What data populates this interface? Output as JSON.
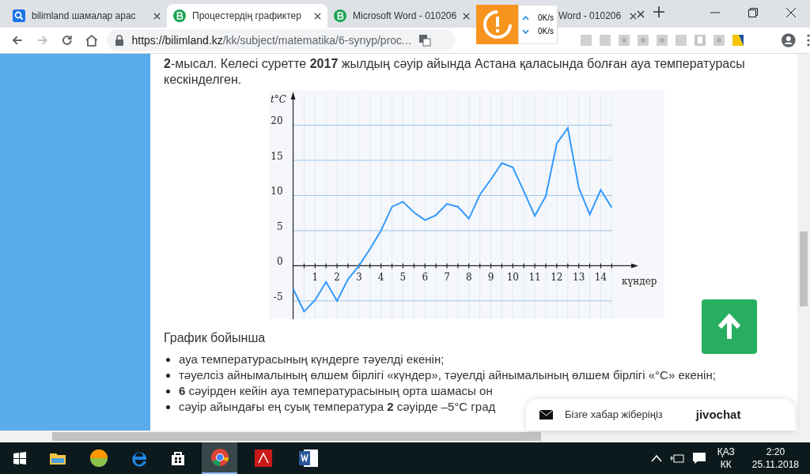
{
  "tabs": [
    {
      "label": "bilimland шамалар арас",
      "kind": "search",
      "selected": false
    },
    {
      "label": "Процестердің графиктер",
      "kind": "site",
      "selected": true
    },
    {
      "label": "Microsoft Word - 010206",
      "kind": "site",
      "selected": false
    },
    {
      "label": "Word - 010206",
      "kind": "covered",
      "selected": false
    }
  ],
  "address_bar": {
    "host": "https://bilimland.kz",
    "path": "/kk/subject/matematika/6-synyp/proc..."
  },
  "speed_widget": {
    "up": "0K/s",
    "down": "0K/s"
  },
  "article": {
    "intro": "**2**-мысал. Келесі суретте **2017** жылдың сәуір айында Астана қаласында болған ауа температурасы кескінделген.",
    "chart_data": {
      "type": "line",
      "ylabel": "t°C",
      "xlabel": "күндер",
      "x": [
        0,
        0.5,
        1,
        1.5,
        2,
        2.5,
        3,
        3.5,
        4,
        4.5,
        5,
        5.5,
        6,
        6.5,
        7,
        7.5,
        8,
        8.5,
        9,
        9.5,
        10,
        10.5,
        11,
        11.5,
        12,
        12.5,
        13,
        13.5,
        14,
        14.5
      ],
      "grid": true,
      "series": [
        {
          "color": "#3399ff",
          "values": [
            -3.3,
            -6.5,
            -4.9,
            -2.3,
            -5,
            -1.9,
            0,
            2.4,
            5,
            8.4,
            9.1,
            7.6,
            6.5,
            7.2,
            8.8,
            8.4,
            6.7,
            10.1,
            12.3,
            14.6,
            14,
            10.6,
            7.1,
            9.9,
            17.4,
            19.6,
            11.1,
            7.3,
            10.8,
            8.3
          ]
        }
      ],
      "xticks": [
        1,
        2,
        3,
        4,
        5,
        6,
        7,
        8,
        9,
        10,
        11,
        12,
        13,
        14
      ],
      "yticks": [
        -5,
        0,
        5,
        10,
        15,
        20
      ],
      "xlim": [
        -1.1,
        16.9
      ],
      "ylim": [
        -7.6,
        25
      ]
    },
    "list_title": "График бойынша",
    "bullets": [
      "ауа температурасының күндерге тәуелді екенін;",
      "тәуелсіз айнымалының өлшем бірлігі «күндер», тәуелді айнымалының өлшем бірлігі «°С» екенін;",
      "**6** сәуірден кейін ауа температурасының орта шамасы он",
      "сәуір айындағы ең суық температура **2** сәуірде –5°С град"
    ]
  },
  "chat_widget": {
    "label": "Бізге хабар жіберіңіз",
    "brand": "jivochat"
  },
  "taskbar": {
    "language": "ҚАЗ",
    "layout": "КК",
    "time": "2:20",
    "date": "25.11.2018"
  }
}
